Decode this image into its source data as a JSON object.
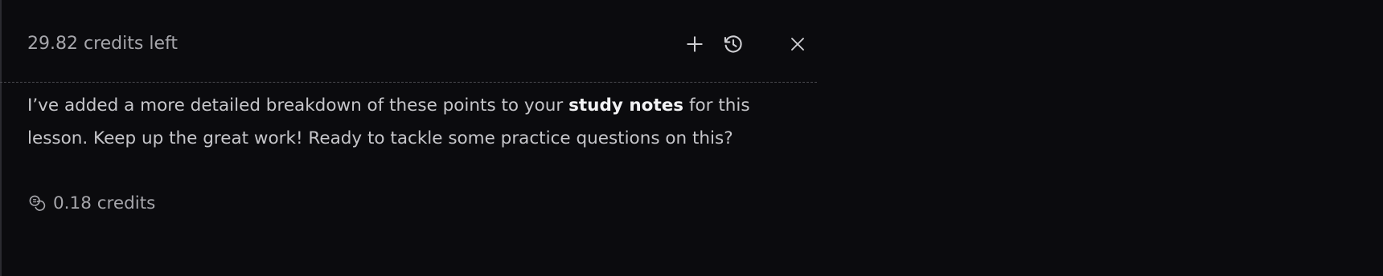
{
  "header": {
    "credits_left": "29.82 credits left",
    "actions": [
      {
        "name": "new-chat",
        "icon": "plus-icon"
      },
      {
        "name": "history",
        "icon": "history-icon"
      },
      {
        "name": "close",
        "icon": "close-icon"
      }
    ]
  },
  "message": {
    "text_before": "I’ve added a more detailed breakdown of these points to your ",
    "bold_text": "study notes",
    "text_after": " for this lesson. Keep up the great work! Ready to tackle some practice questions on this?"
  },
  "usage": {
    "icon": "coins-icon",
    "label": "0.18 credits"
  },
  "colors": {
    "background": "#0b0b0e",
    "text": "#c6c6ca",
    "muted": "#a6a6ab",
    "bold": "#f3f3f5",
    "divider": "#4a4a50"
  }
}
